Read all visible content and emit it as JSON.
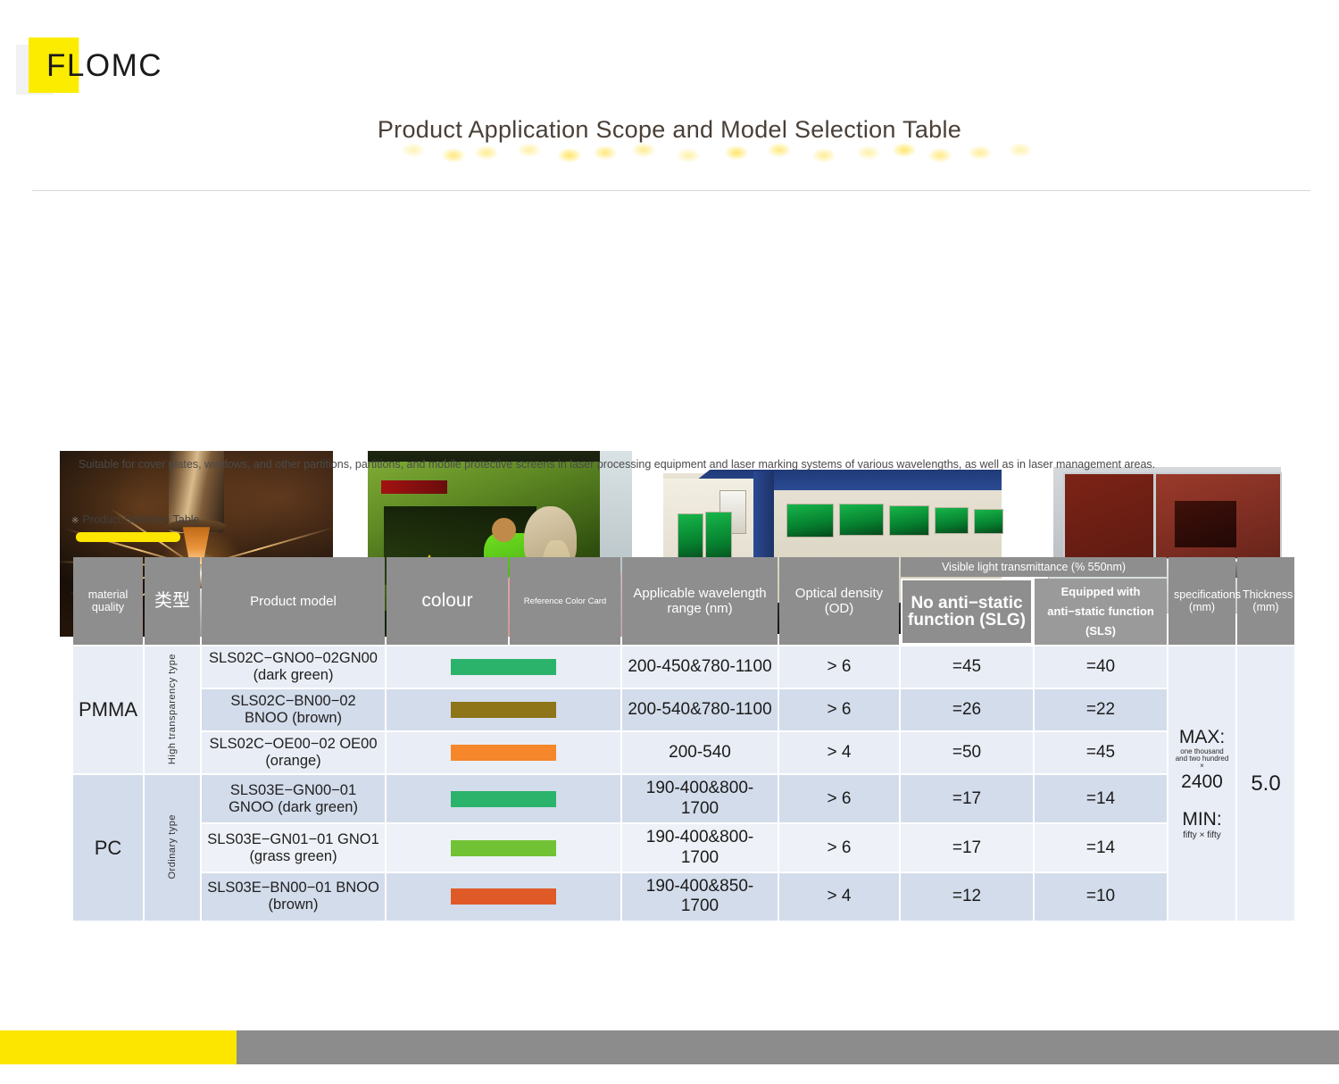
{
  "brand": {
    "name": "FLOMC"
  },
  "header": {
    "title": "Product Application Scope and Model Selection Table"
  },
  "photos": [
    {
      "caption_name": "laser-cutting-sparks-photo"
    },
    {
      "caption_name": "laser-lab-operator-photo"
    },
    {
      "caption_name": "enclosed-laser-machine-photo"
    },
    {
      "caption_name": "laser-marking-cabinet-photo"
    }
  ],
  "description": "Suitable for cover plates, windows, and other partitions, partitions, and mobile protective screens in laser processing equipment and laser marking systems of various wavelengths, as well as in laser management areas.",
  "section": {
    "mark": "※",
    "label": "Product Selection Table"
  },
  "table": {
    "headers": {
      "material_quality": "material quality",
      "type": "类型",
      "product_model": "Product model",
      "colour": "colour",
      "reference_color_card": "Reference Color Card",
      "wavelength": "Applicable wavelength range (nm)",
      "optical_density": "Optical density (OD)",
      "transmittance_group": "Visible light transmittance (% 550nm)",
      "no_antistatic": "No anti−static function (SLG)",
      "with_antistatic": "Equipped with anti−static function (SLS)",
      "specifications": "specifications (mm)",
      "thickness": "Thickness (mm)"
    },
    "groups": [
      {
        "material": "PMMA",
        "type": "High transparency type",
        "rows": [
          {
            "model": "SLS02C−GNO0−02GN00 (dark green)",
            "swatch": "#2bb36b",
            "wavelength": "200-450&780-1100",
            "od": "> 6",
            "slg": "=45",
            "sls": "=40"
          },
          {
            "model": "SLS02C−BN00−02 BNOO (brown)",
            "swatch": "#8d7518",
            "wavelength": "200-540&780-1100",
            "od": "> 6",
            "slg": "=26",
            "sls": "=22"
          },
          {
            "model": "SLS02C−OE00−02 OE00 (orange)",
            "swatch": "#f5862a",
            "wavelength": "200-540",
            "od": "> 4",
            "slg": "=50",
            "sls": "=45"
          }
        ]
      },
      {
        "material": "PC",
        "type": "Ordinary type",
        "rows": [
          {
            "model": "SLS03E−GN00−01 GNOO (dark green)",
            "swatch": "#2bb36b",
            "wavelength": "190-400&800-1700",
            "od": "> 6",
            "slg": "=17",
            "sls": "=14"
          },
          {
            "model": "SLS03E−GN01−01 GNO1 (grass green)",
            "swatch": "#71c234",
            "wavelength": "190-400&800-1700",
            "od": "> 6",
            "slg": "=17",
            "sls": "=14"
          },
          {
            "model": "SLS03E−BN00−01 BNOO (brown)",
            "swatch": "#df5a27",
            "wavelength": "190-400&850-1700",
            "od": "> 4",
            "slg": "=12",
            "sls": "=10"
          }
        ]
      }
    ],
    "specifications_cell": {
      "max_label": "MAX:",
      "max_words": "one thousand and two hundred ×",
      "max_value": "2400",
      "min_label": "MIN:",
      "min_words": "fifty × fifty"
    },
    "thickness_value": "5.0"
  },
  "colors": {
    "brand_yellow": "#fce600",
    "header_gray": "#8e8e8e",
    "row_light": "#e9edf5",
    "row_alt": "#d3dceb",
    "title_text": "#4a4038"
  }
}
